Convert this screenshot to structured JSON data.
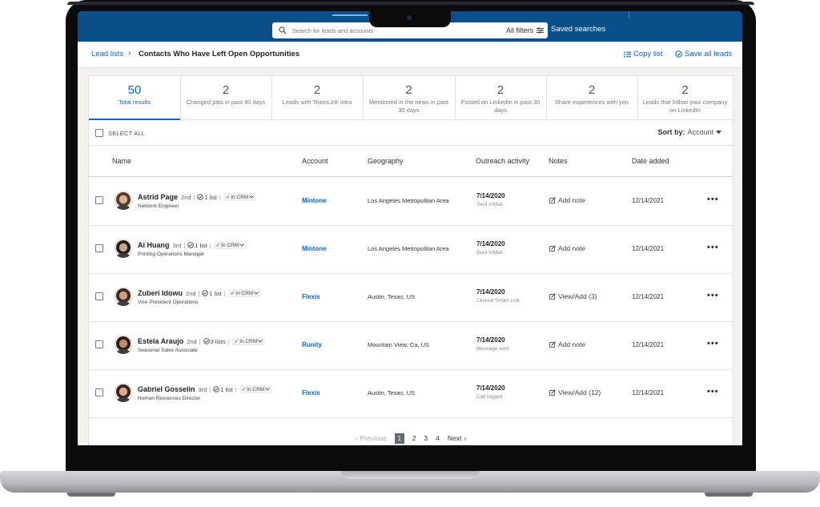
{
  "search": {
    "placeholder": "Search for leads and accounts",
    "filters_label": "All filters",
    "saved_searches_label": "Saved searches"
  },
  "breadcrumb": {
    "parent": "Lead lists",
    "current": "Contacts Who Have Left Open Opportunities"
  },
  "actions": {
    "copy_list": "Copy list",
    "save_all": "Save all leads"
  },
  "stats": [
    {
      "value": "50",
      "label": "Total results"
    },
    {
      "value": "2",
      "label": "Changed jobs in past 90 days"
    },
    {
      "value": "2",
      "label": "Leads with TeamLink intro"
    },
    {
      "value": "2",
      "label": "Mentioned in the news in past 30 days"
    },
    {
      "value": "2",
      "label": "Posted on LinkedIn in past 30 days"
    },
    {
      "value": "2",
      "label": "Share experiences with you"
    },
    {
      "value": "2",
      "label": "Leads that follow your company on LinkedIn"
    }
  ],
  "select_all": "SELECT ALL",
  "sort": {
    "label": "Sort by:",
    "value": "Account"
  },
  "columns": {
    "name": "Name",
    "account": "Account",
    "geography": "Geography",
    "outreach": "Outreach activity",
    "notes": "Notes",
    "date_added": "Date added"
  },
  "rows": [
    {
      "name": "Astrid Page",
      "degree": "2nd",
      "lists": "1 list",
      "crm": "In CRM",
      "title": "Network Engineer",
      "account": "Mintone",
      "geography": "Los Angeles Metropolitan Area",
      "outreach_date": "7/14/2020",
      "outreach_activity": "Sent InMail",
      "note": "Add note",
      "date_added": "12/14/2021",
      "more": "•••"
    },
    {
      "name": "Ai Huang",
      "degree": "3rd",
      "lists": "1 list",
      "crm": "In CRM",
      "title": "Printing Operations Manager",
      "account": "Mintone",
      "geography": "Los Angeles Metropolitan Area",
      "outreach_date": "7/14/2020",
      "outreach_activity": "Sent InMail",
      "note": "Add note",
      "date_added": "12/14/2021",
      "more": "•••"
    },
    {
      "name": "Zuberi Idowu",
      "degree": "2nd",
      "lists": "1 list",
      "crm": "In CRM",
      "title": "Vice President Operations",
      "account": "Flexis",
      "geography": "Austin, Texas, US",
      "outreach_date": "7/14/2020",
      "outreach_activity": "Clicked Smart Link",
      "note": "View/Add (3)",
      "date_added": "12/14/2021",
      "more": "•••"
    },
    {
      "name": "Estela Araujo",
      "degree": "2nd",
      "lists": "3 lists",
      "crm": "In CRM",
      "title": "Seasonal Sales Associate",
      "account": "Runity",
      "geography": "Mountain View, Ca, US",
      "outreach_date": "7/14/2020",
      "outreach_activity": "Message sent",
      "note": "Add note",
      "date_added": "12/14/2021",
      "more": "•••"
    },
    {
      "name": "Gabriel Gosselin",
      "degree": "3rd",
      "lists": "1 list",
      "crm": "In CRM",
      "title": "Human Resources Director",
      "account": "Flexis",
      "geography": "Austin, Texas, US",
      "outreach_date": "7/14/2020",
      "outreach_activity": "Call logged",
      "note": "View/Add (12)",
      "date_added": "12/14/2021",
      "more": "•••"
    }
  ],
  "pagination": {
    "previous": "Previous",
    "pages": [
      "1",
      "2",
      "3",
      "4"
    ],
    "current": "1",
    "next": "Next"
  },
  "colors": {
    "brand_bar": "#0b4f8a",
    "link": "#0a66c2",
    "page_bg": "#f3f2ef"
  },
  "icons": {
    "search": "search-icon",
    "filters": "filters-icon",
    "copy": "list-icon",
    "save": "check-circle-icon",
    "note": "edit-note-icon",
    "more": "more-icon"
  }
}
